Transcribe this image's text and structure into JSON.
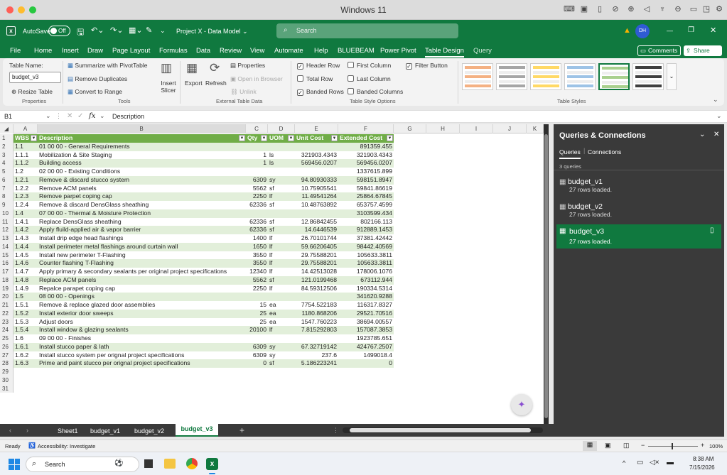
{
  "os": {
    "window_title": "Windows 11"
  },
  "title_bar": {
    "autosave_label": "AutoSave",
    "autosave_state": "Off",
    "doc_title": "Project X - Data Model ⌄",
    "search_placeholder": "Search",
    "user_initials": "DH"
  },
  "menu": {
    "tabs": [
      "File",
      "Home",
      "Insert",
      "Draw",
      "Page Layout",
      "Formulas",
      "Data",
      "Review",
      "View",
      "Automate",
      "Help",
      "BLUEBEAM",
      "Power Pivot",
      "Table Design",
      "Query"
    ],
    "active": "Table Design",
    "comments_label": "Comments",
    "share_label": "Share"
  },
  "ribbon": {
    "properties": {
      "table_name_label": "Table Name:",
      "table_name_value": "budget_v3",
      "resize_label": "Resize Table",
      "group": "Properties"
    },
    "tools": {
      "summarize": "Summarize with PivotTable",
      "remove_dup": "Remove Duplicates",
      "convert": "Convert to Range",
      "insert_slicer": "Insert Slicer",
      "group": "Tools"
    },
    "external": {
      "export": "Export",
      "refresh": "Refresh",
      "properties": "Properties",
      "open_browser": "Open in Browser",
      "unlink": "Unlink",
      "group": "External Table Data"
    },
    "style_options": {
      "header_row": "Header Row",
      "total_row": "Total Row",
      "banded_rows": "Banded Rows",
      "first_column": "First Column",
      "last_column": "Last Column",
      "banded_columns": "Banded Columns",
      "filter_button": "Filter Button",
      "group": "Table Style Options"
    },
    "styles": {
      "group": "Table Styles",
      "swatches": [
        "#f4b183",
        "#a6a6a6",
        "#ffd966",
        "#9dc3e6",
        "#a9d08e",
        "#404040"
      ]
    }
  },
  "formula": {
    "cell_ref": "B1",
    "fx": "fx",
    "content": "Description"
  },
  "columns": [
    "A",
    "B",
    "C",
    "D",
    "E",
    "F",
    "G",
    "H",
    "I",
    "J",
    "K"
  ],
  "table": {
    "headers": [
      "WBS",
      "Description",
      "Qty",
      "UOM",
      "Unit Cost",
      "Extended Cost"
    ],
    "rows": [
      [
        "1.1",
        "01 00 00 - General Requirements",
        "",
        "",
        "",
        "891359.455"
      ],
      [
        "1.1.1",
        "Mobilization & Site Staging",
        "1",
        "ls",
        "321903.4343",
        "321903.4343"
      ],
      [
        "1.1.2",
        "Building access",
        "1",
        "ls",
        "569456.0207",
        "569456.0207"
      ],
      [
        "1.2",
        "02 00 00 - Existing Conditions",
        "",
        "",
        "",
        "1337615.899"
      ],
      [
        "1.2.1",
        "Remove & discard stucco system",
        "6309",
        "sy",
        "94.80930333",
        "598151.8947"
      ],
      [
        "1.2.2",
        "Remove ACM panels",
        "5562",
        "sf",
        "10.75905541",
        "59841.86619"
      ],
      [
        "1.2.3",
        "Remove parpet coping cap",
        "2250",
        "lf",
        "11.49541264",
        "25864.67845"
      ],
      [
        "1.2.4",
        "Remove & discard DensGlass sheathing",
        "62336",
        "sf",
        "10.48763892",
        "653757.4599"
      ],
      [
        "1.4",
        "07 00 00 - Thermal & Moisture Protection",
        "",
        "",
        "",
        "3103599.434"
      ],
      [
        "1.4.1",
        "Replace DensGlass sheathing",
        "62336",
        "sf",
        "12.86842455",
        "802166.113"
      ],
      [
        "1.4.2",
        "Apply fluild-applied air & vapor barrier",
        "62336",
        "sf",
        "14.6446539",
        "912889.1453"
      ],
      [
        "1.4.3",
        "Install drip edge head flashings",
        "1400",
        "lf",
        "26.70101744",
        "37381.42442"
      ],
      [
        "1.4.4",
        "Install perimeter metal flashings around curtain wall",
        "1650",
        "lf",
        "59.66206405",
        "98442.40569"
      ],
      [
        "1.4.5",
        "Install new perimeter T-Flashing",
        "3550",
        "lf",
        "29.75588201",
        "105633.3811"
      ],
      [
        "1.4.6",
        "Counter flashing T-Flashing",
        "3550",
        "lf",
        "29.75588201",
        "105633.3811"
      ],
      [
        "1.4.7",
        "Apply primary & secondary sealants per original project specifications",
        "12340",
        "lf",
        "14.42513028",
        "178006.1076"
      ],
      [
        "1.4.8",
        "Replace ACM panels",
        "5562",
        "sf",
        "121.0199468",
        "673112.944"
      ],
      [
        "1.4.9",
        "Repalce parapet coping cap",
        "2250",
        "lf",
        "84.59312506",
        "190334.5314"
      ],
      [
        "1.5",
        "08 00 00 - Openings",
        "",
        "",
        "",
        "341620.9288"
      ],
      [
        "1.5.1",
        "Remove & replace glazed door assemblies",
        "15",
        "ea",
        "7754.522183",
        "116317.8327"
      ],
      [
        "1.5.2",
        "Install exterior door sweeps",
        "25",
        "ea",
        "1180.868206",
        "29521.70516"
      ],
      [
        "1.5.3",
        "Adjust doors",
        "25",
        "ea",
        "1547.760223",
        "38694.00557"
      ],
      [
        "1.5.4",
        "Install window & glazing sealants",
        "20100",
        "lf",
        "7.815292803",
        "157087.3853"
      ],
      [
        "1.6",
        "09 00 00 - Finishes",
        "",
        "",
        "",
        "1923785.651"
      ],
      [
        "1.6.1",
        "Install stucco paper & lath",
        "6309",
        "sy",
        "67.32719142",
        "424767.2507"
      ],
      [
        "1.6.2",
        "Install stucco system per orignal project specifications",
        "6309",
        "sy",
        "237.6",
        "1499018.4"
      ],
      [
        "1.6.3",
        "Prime and paint stucco per orignal project specifications",
        "0",
        "sf",
        "5.186223241",
        "0"
      ]
    ],
    "empty_rows": [
      "29",
      "30",
      "31"
    ]
  },
  "sheets": {
    "tabs": [
      "Sheet1",
      "budget_v1",
      "budget_v2",
      "budget_v3"
    ],
    "active": "budget_v3"
  },
  "pane": {
    "title": "Queries & Connections",
    "tab_queries": "Queries",
    "tab_connections": "Connections",
    "count": "3 queries",
    "items": [
      {
        "name": "budget_v1",
        "status": "27 rows loaded."
      },
      {
        "name": "budget_v2",
        "status": "27 rows loaded."
      },
      {
        "name": "budget_v3",
        "status": "27 rows loaded."
      }
    ]
  },
  "status": {
    "ready": "Ready",
    "accessibility": "Accessibility: Investigate",
    "zoom": "100%"
  },
  "taskbar": {
    "search": "Search",
    "time": "8:38 AM",
    "date": "7/15/2026"
  }
}
